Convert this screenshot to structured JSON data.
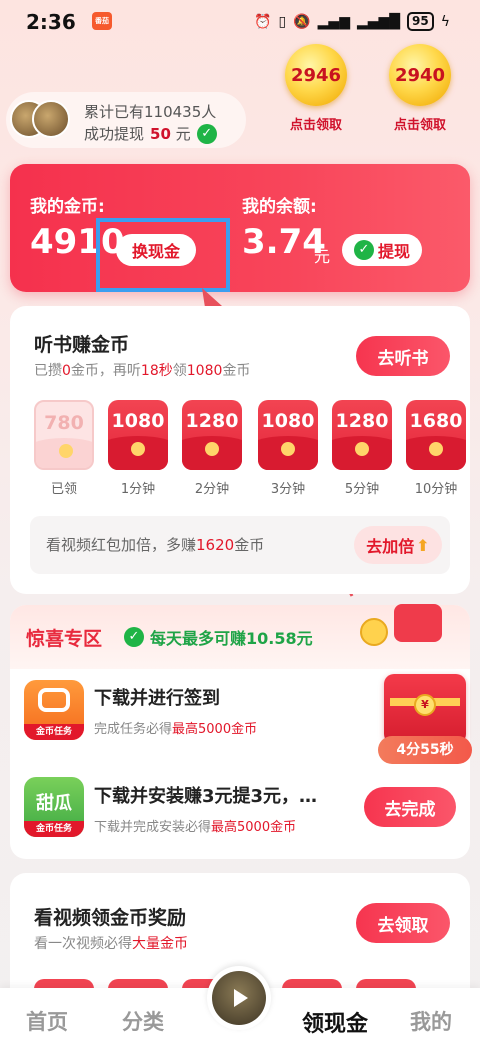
{
  "status_bar": {
    "time": "2:36",
    "app_badge": "番茄",
    "icons": [
      "alarm-icon",
      "vibrate-icon",
      "mute-icon",
      "signal-icon",
      "signal-icon",
      "battery-icon",
      "charging-icon"
    ],
    "battery": "95"
  },
  "top": {
    "stat_line1": "累计已有110435人",
    "stat_prefix": "成功提现",
    "stat_amount": "50",
    "stat_unit": "元",
    "coins": [
      {
        "value": "2946",
        "label": "点击领取"
      },
      {
        "value": "2940",
        "label": "点击领取"
      }
    ]
  },
  "balance": {
    "coins_label": "我的金币:",
    "coins_value": "4910",
    "exchange_btn": "换现金",
    "cash_label": "我的余额:",
    "cash_value": "3.74",
    "cash_unit": "元",
    "withdraw_btn": "提现"
  },
  "listen": {
    "title": "听书赚金币",
    "sub_parts": [
      "已攒",
      "0",
      "金币，再听",
      "18秒",
      "领",
      "1080",
      "金币"
    ],
    "cta": "去听书",
    "envelopes": [
      {
        "value": "780",
        "label": "已领",
        "done": true
      },
      {
        "value": "1080",
        "label": "1分钟",
        "done": false
      },
      {
        "value": "1280",
        "label": "2分钟",
        "done": false
      },
      {
        "value": "1080",
        "label": "3分钟",
        "done": false
      },
      {
        "value": "1280",
        "label": "5分钟",
        "done": false
      },
      {
        "value": "1680",
        "label": "10分钟",
        "done": false
      }
    ],
    "double_prefix": "看视频红包加倍，多赚",
    "double_amount": "1620",
    "double_suffix": "金币",
    "double_btn": "去加倍"
  },
  "surprise": {
    "title": "惊喜专区",
    "subtitle": "每天最多可赚10.58元",
    "tasks": [
      {
        "icon_badge": "金币任务",
        "title": "下载并进行签到",
        "sub_prefix": "完成任务必得",
        "sub_red": "最高5000金币",
        "icon_text": "",
        "icon_color": "#f6812e"
      },
      {
        "icon_badge": "金币任务",
        "title": "下载并安装赚3元提3元，…",
        "sub_prefix": "下载并完成安装必得",
        "sub_red": "最高5000金币",
        "btn": "去完成",
        "icon_text": "甜瓜",
        "icon_color": "#4cc157"
      }
    ],
    "timer": "4分55秒"
  },
  "video": {
    "title": "看视频领金币奖励",
    "sub_prefix": "看一次视频必得",
    "sub_red": "大量金币",
    "cta": "去领取"
  },
  "nav": {
    "items": [
      "首页",
      "分类",
      "领现金",
      "我的"
    ],
    "active": "领现金"
  },
  "colors": {
    "accent": "#f5314d",
    "wechat": "#1fb446",
    "highlight": "#3b9ef0"
  }
}
